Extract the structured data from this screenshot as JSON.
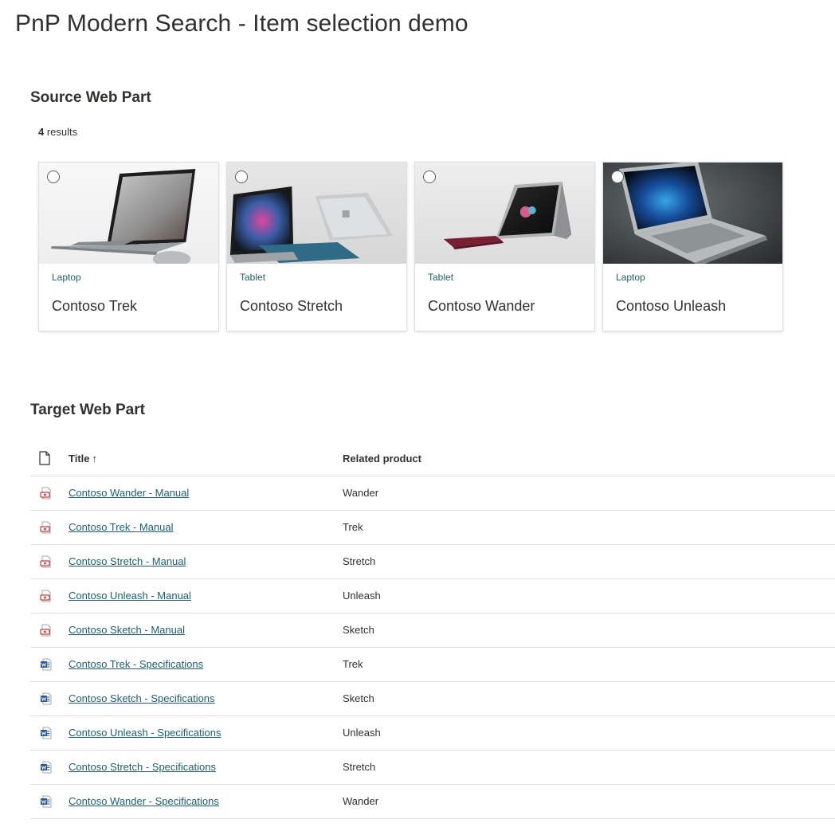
{
  "page": {
    "title": "PnP Modern Search - Item selection demo"
  },
  "source": {
    "title": "Source Web Part",
    "results_count": "4",
    "results_label": " results",
    "cards": [
      {
        "category": "Laptop",
        "title": "Contoso Trek",
        "selected": false
      },
      {
        "category": "Tablet",
        "title": "Contoso Stretch",
        "selected": false
      },
      {
        "category": "Tablet",
        "title": "Contoso Wander",
        "selected": false
      },
      {
        "category": "Laptop",
        "title": "Contoso Unleash",
        "selected": false
      }
    ]
  },
  "target": {
    "title": "Target Web Part",
    "columns": {
      "title": "Title",
      "sort_indicator": "↑",
      "related": "Related product"
    },
    "rows": [
      {
        "icon": "pdf-icon",
        "title": "Contoso Wander - Manual",
        "related": "Wander"
      },
      {
        "icon": "pdf-icon",
        "title": "Contoso Trek - Manual",
        "related": "Trek"
      },
      {
        "icon": "pdf-icon",
        "title": "Contoso Stretch - Manual",
        "related": "Stretch"
      },
      {
        "icon": "pdf-icon",
        "title": "Contoso Unleash - Manual",
        "related": "Unleash"
      },
      {
        "icon": "pdf-icon",
        "title": "Contoso Sketch - Manual",
        "related": "Sketch"
      },
      {
        "icon": "word-icon",
        "title": "Contoso Trek - Specifications",
        "related": "Trek"
      },
      {
        "icon": "word-icon",
        "title": "Contoso Sketch - Specifications",
        "related": "Sketch"
      },
      {
        "icon": "word-icon",
        "title": "Contoso Unleash - Specifications",
        "related": "Unleash"
      },
      {
        "icon": "word-icon",
        "title": "Contoso Stretch - Specifications",
        "related": "Stretch"
      },
      {
        "icon": "word-icon",
        "title": "Contoso Wander - Specifications",
        "related": "Wander"
      }
    ]
  },
  "colors": {
    "link": "#1b5f73",
    "text": "#323130",
    "divider": "#e1dfdd",
    "pdf": "#d13438",
    "word": "#2b579a"
  }
}
